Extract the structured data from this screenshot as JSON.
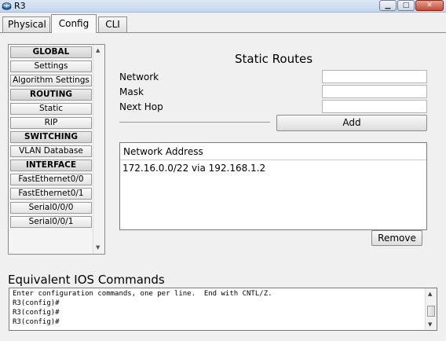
{
  "window": {
    "title": "R3"
  },
  "tabs": [
    {
      "label": "Physical"
    },
    {
      "label": "Config",
      "active": true
    },
    {
      "label": "CLI"
    }
  ],
  "nav": {
    "items": [
      {
        "label": "GLOBAL",
        "header": true
      },
      {
        "label": "Settings"
      },
      {
        "label": "Algorithm Settings"
      },
      {
        "label": "ROUTING",
        "header": true
      },
      {
        "label": "Static"
      },
      {
        "label": "RIP"
      },
      {
        "label": "SWITCHING",
        "header": true
      },
      {
        "label": "VLAN Database"
      },
      {
        "label": "INTERFACE",
        "header": true
      },
      {
        "label": "FastEthernet0/0"
      },
      {
        "label": "FastEthernet0/1"
      },
      {
        "label": "Serial0/0/0"
      },
      {
        "label": "Serial0/0/1"
      }
    ]
  },
  "static_routes": {
    "title": "Static Routes",
    "network_label": "Network",
    "network_value": "",
    "mask_label": "Mask",
    "mask_value": "",
    "next_hop_label": "Next Hop",
    "next_hop_value": "",
    "add_label": "Add",
    "list_header": "Network Address",
    "routes": [
      "172.16.0.0/22 via 192.168.1.2"
    ],
    "remove_label": "Remove"
  },
  "ios": {
    "title": "Equivalent IOS Commands",
    "lines": [
      "Enter configuration commands, one per line.  End with CNTL/Z.",
      "R3(config)#",
      "R3(config)#",
      "R3(config)#"
    ]
  },
  "icons": {
    "app": "router-icon",
    "minimize": "minimize-icon",
    "maximize": "maximize-icon",
    "close": "close-icon",
    "scroll_up": "arrow-up-icon",
    "scroll_down": "arrow-down-icon"
  }
}
